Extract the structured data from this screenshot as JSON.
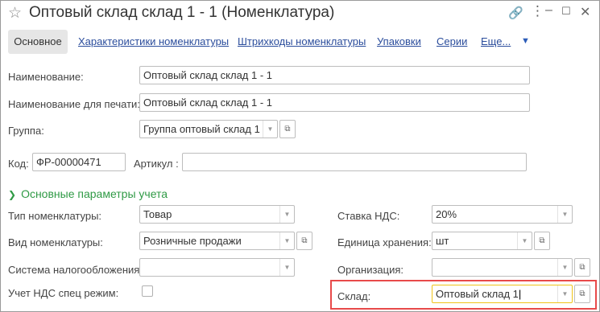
{
  "window": {
    "title": "Оптовый склад склад 1 - 1 (Номенклатура)"
  },
  "tabs": {
    "active": "Основное",
    "items": [
      "Характеристики номенклатуры",
      "Штрихкоды номенклатуры",
      "Упаковки",
      "Серии",
      "Еще..."
    ]
  },
  "form": {
    "name_label": "Наименование:",
    "name_value": "Оптовый склад склад 1 - 1",
    "print_name_label": "Наименование для печати:",
    "print_name_value": "Оптовый склад склад 1 - 1",
    "group_label": "Группа:",
    "group_value": "Группа оптовый склад 1",
    "code_label": "Код:",
    "code_value": "ФР-00000471",
    "article_label": "Артикул :",
    "article_value": ""
  },
  "section": {
    "title": "Основные параметры учета"
  },
  "params": {
    "type_label": "Тип номенклатуры:",
    "type_value": "Товар",
    "kind_label": "Вид номенклатуры:",
    "kind_value": "Розничные продажи",
    "tax_label": "Система налогообложения:",
    "tax_value": "",
    "vat_special_label": "Учет НДС спец режим:",
    "vat_special_checked": false,
    "vat_rate_label": "Ставка НДС:",
    "vat_rate_value": "20%",
    "unit_label": "Единица хранения:",
    "unit_value": "шт",
    "org_label": "Организация:",
    "org_value": "",
    "warehouse_label": "Склад:",
    "warehouse_value": "Оптовый склад 1"
  },
  "colors": {
    "link": "#2b4d9c",
    "section": "#2f9a45",
    "highlight": "#e84a4a",
    "focus": "#f0c419"
  },
  "icons": [
    "star-icon",
    "link-icon",
    "more-icon",
    "minimize-icon",
    "maximize-icon",
    "close-icon",
    "dropdown-icon",
    "open-icon",
    "chevron-down-icon"
  ]
}
